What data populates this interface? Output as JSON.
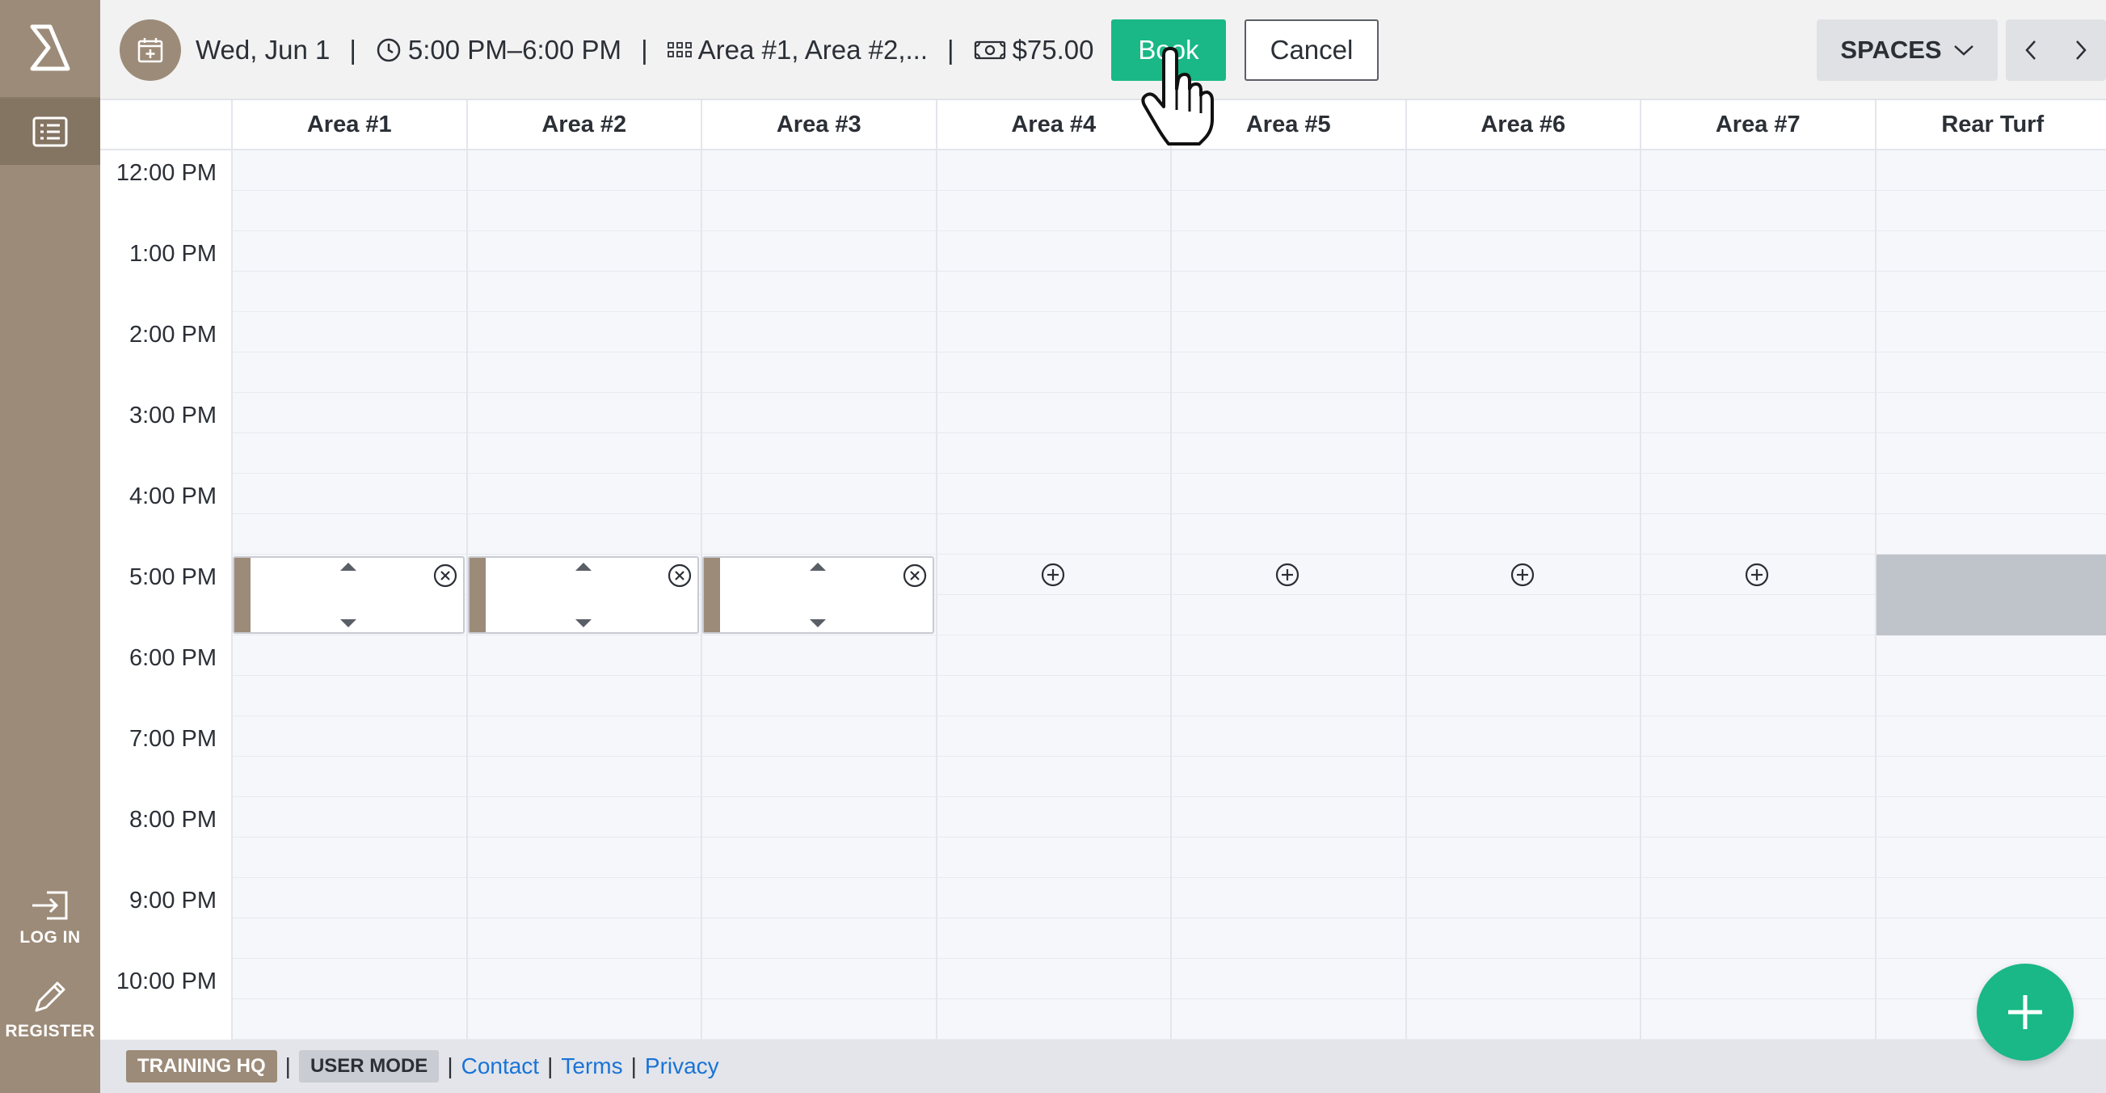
{
  "sidebar": {
    "logo_icon": "brand-chevron-logo",
    "list_icon": "list-icon",
    "login_label": "LOG IN",
    "register_label": "REGISTER"
  },
  "topbar": {
    "date": "Wed, Jun 1",
    "time_range": "5:00 PM–6:00 PM",
    "areas": "Area #1, Area #2,...",
    "price": "$75.00",
    "separator": "|",
    "book_label": "Book",
    "cancel_label": "Cancel",
    "spaces_label": "SPACES"
  },
  "columns": [
    "Area #1",
    "Area #2",
    "Area #3",
    "Area #4",
    "Area #5",
    "Area #6",
    "Area #7",
    "Rear Turf"
  ],
  "times": [
    "12:00 PM",
    "1:00 PM",
    "2:00 PM",
    "3:00 PM",
    "4:00 PM",
    "5:00 PM",
    "6:00 PM",
    "7:00 PM",
    "8:00 PM",
    "9:00 PM",
    "10:00 PM"
  ],
  "selection": {
    "time": "5:00 PM",
    "selected_columns": [
      "Area #1",
      "Area #2",
      "Area #3"
    ],
    "available_columns": [
      "Area #4",
      "Area #5",
      "Area #6",
      "Area #7"
    ],
    "unavailable_columns": [
      "Rear Turf"
    ]
  },
  "footer": {
    "org": "TRAINING HQ",
    "mode": "USER MODE",
    "links": [
      "Contact",
      "Terms",
      "Privacy"
    ]
  },
  "colors": {
    "brand": "#9c8b78",
    "accent": "#19b886",
    "link": "#1a73d6"
  }
}
